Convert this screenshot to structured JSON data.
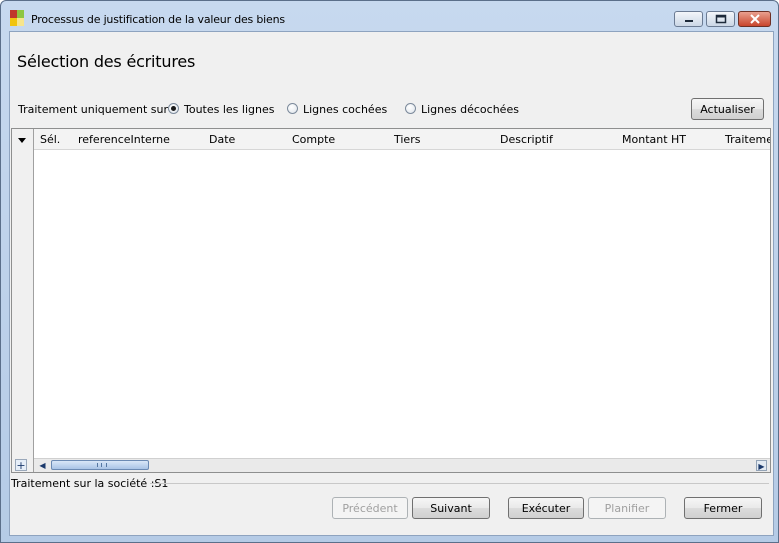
{
  "window": {
    "title": "Processus de justification de la valeur des biens",
    "icon": "app-icon",
    "controls": [
      "minimize-icon",
      "maximize-icon",
      "close-icon"
    ]
  },
  "page": {
    "heading": "Sélection des écritures"
  },
  "filter": {
    "label": "Traitement uniquement sur :",
    "options": [
      {
        "label": "Toutes les lignes",
        "checked": true
      },
      {
        "label": "Lignes cochées",
        "checked": false
      },
      {
        "label": "Lignes décochées",
        "checked": false
      }
    ],
    "refresh_label": "Actualiser"
  },
  "grid": {
    "columns": [
      "Sél.",
      "referenceInterne",
      "Date",
      "Compte",
      "Tiers",
      "Descriptif",
      "Montant HT",
      "Traitemen"
    ],
    "rows": []
  },
  "status": {
    "text": "Traitement sur la société :S1"
  },
  "footer": {
    "previous_label": "Précédent",
    "next_label": "Suivant",
    "execute_label": "Exécuter",
    "schedule_label": "Planifier",
    "close_label": "Fermer"
  }
}
